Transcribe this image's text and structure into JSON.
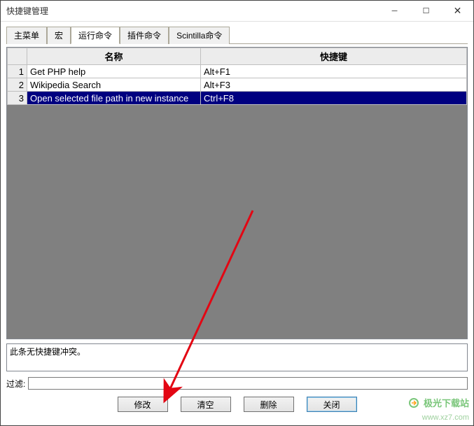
{
  "window": {
    "title": "快捷键管理"
  },
  "tabs": [
    {
      "label": "主菜单",
      "active": false
    },
    {
      "label": "宏",
      "active": false
    },
    {
      "label": "运行命令",
      "active": true
    },
    {
      "label": "插件命令",
      "active": false
    },
    {
      "label": "Scintilla命令",
      "active": false
    }
  ],
  "columns": {
    "rownum": "",
    "name": "名称",
    "shortcut": "快捷键"
  },
  "rows": [
    {
      "n": "1",
      "name": "Get PHP help",
      "shortcut": "Alt+F1",
      "selected": false
    },
    {
      "n": "2",
      "name": "Wikipedia Search",
      "shortcut": "Alt+F3",
      "selected": false
    },
    {
      "n": "3",
      "name": "Open selected file path in new instance",
      "shortcut": "Ctrl+F8",
      "selected": true
    }
  ],
  "status": "此条无快捷键冲突。",
  "filter": {
    "label": "过滤:",
    "value": ""
  },
  "buttons": {
    "modify": "修改",
    "clear": "清空",
    "delete": "删除",
    "close": "关闭"
  },
  "watermark": {
    "line1": "极光下载站",
    "line2": "www.xz7.com"
  }
}
